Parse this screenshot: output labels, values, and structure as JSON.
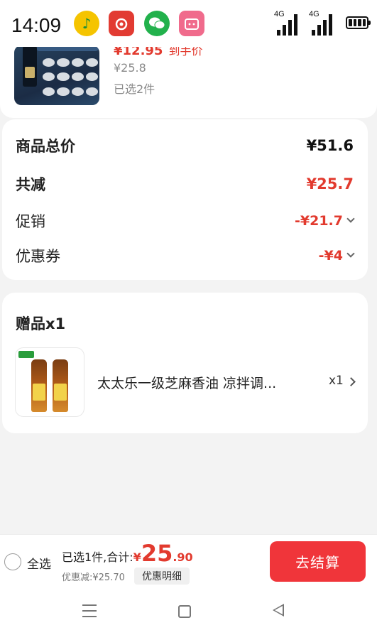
{
  "status_bar": {
    "time": "14:09",
    "apps": [
      "qq-music-icon",
      "netease-music-icon",
      "wechat-icon",
      "bilibili-icon"
    ],
    "signal1": "4G",
    "signal2": "4G"
  },
  "product": {
    "price_prefix": "¥12.95",
    "price_label": "到手价",
    "original_price": "¥25.8",
    "selected": "已选2件"
  },
  "summary": {
    "total_label": "商品总价",
    "total_value": "¥51.6",
    "reduce_label": "共减",
    "reduce_value": "¥25.7",
    "promo_label": "促销",
    "promo_value": "-¥21.7",
    "coupon_label": "优惠券",
    "coupon_value": "-¥4"
  },
  "gift": {
    "title": "赠品x1",
    "name": "太太乐一级芝麻香油 凉拌调...",
    "qty": "x1"
  },
  "bottom": {
    "select_all": "全选",
    "summary_prefix": "已选1件,合计:",
    "currency": "¥",
    "amount_int": "25",
    "amount_dec": ".90",
    "discount": "优惠减:¥25.70",
    "detail_button": "优惠明细",
    "checkout_button": "去结算"
  },
  "colors": {
    "accent_red": "#e23a2e",
    "checkout_bg": "#f0353a"
  }
}
